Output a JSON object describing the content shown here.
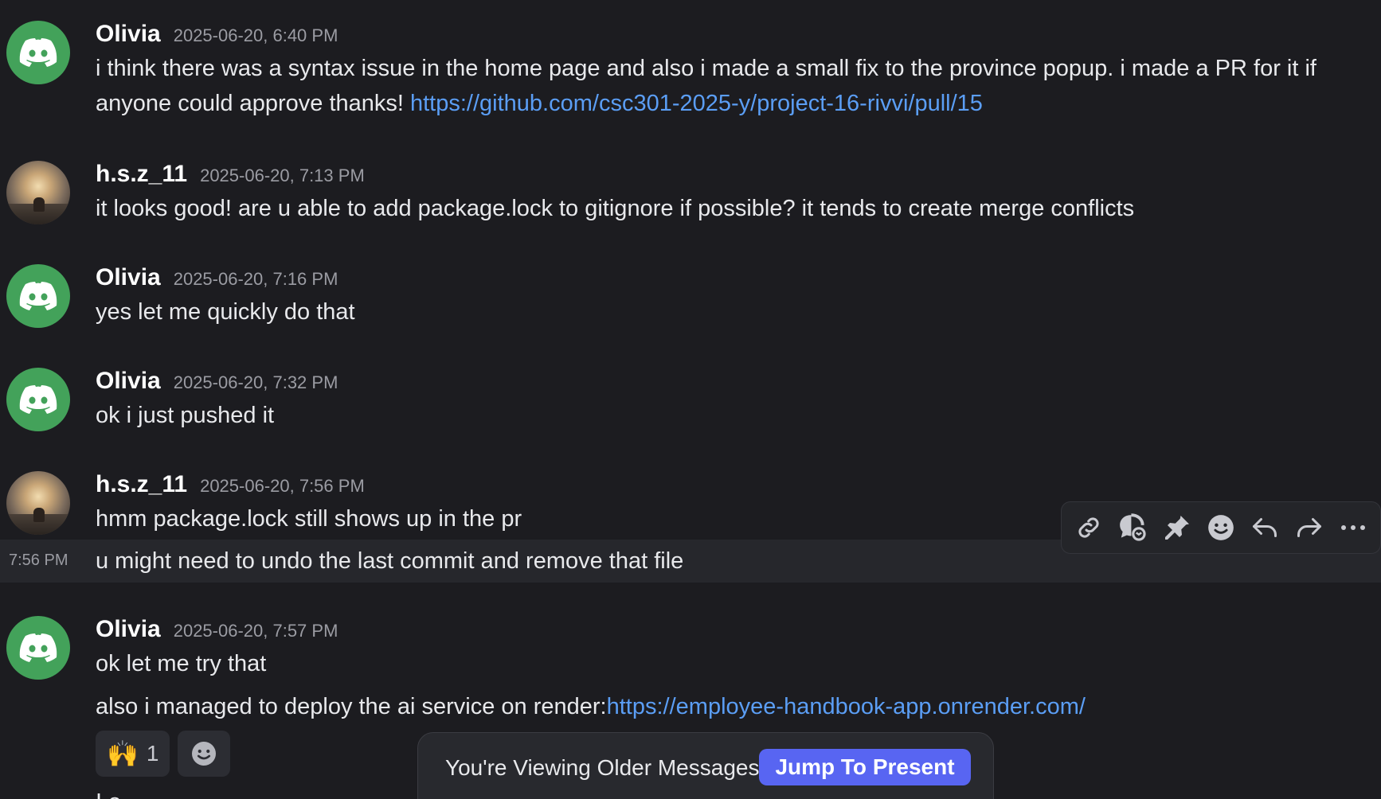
{
  "messages": [
    {
      "username": "Olivia",
      "avatar": "discord-icon",
      "timestamp": "2025-06-20, 6:40 PM",
      "text": "i think there was a syntax issue in the home page and also i made a small fix to the province popup. i made a PR for it if anyone could approve thanks! ",
      "link": "https://github.com/csc301-2025-y/project-16-rivvi/pull/15"
    },
    {
      "username": "h.s.z_11",
      "avatar": "photo",
      "timestamp": "2025-06-20, 7:13 PM",
      "text": "it looks good! are u able to add package.lock to gitignore if possible? it tends to create merge conflicts"
    },
    {
      "username": "Olivia",
      "avatar": "discord-icon",
      "timestamp": "2025-06-20, 7:16 PM",
      "text": "yes let me quickly do that"
    },
    {
      "username": "Olivia",
      "avatar": "discord-icon",
      "timestamp": "2025-06-20, 7:32 PM",
      "text": "ok i just pushed it"
    },
    {
      "username": "h.s.z_11",
      "avatar": "photo",
      "timestamp": "2025-06-20, 7:56 PM",
      "text": "hmm package.lock still shows up in the pr",
      "followup_time": "7:56 PM",
      "followup_text": "u might need to undo the last commit and remove that file"
    },
    {
      "username": "Olivia",
      "avatar": "discord-icon",
      "timestamp": "2025-06-20, 7:57 PM",
      "text": "ok let me try that",
      "followup_text": "also i managed to deploy the ai service on render:",
      "followup_link": "https://employee-handbook-app.onrender.com/"
    }
  ],
  "reactions": [
    {
      "emoji": "🙌",
      "count": "1"
    },
    {
      "emoji": "add-reaction-icon"
    }
  ],
  "toolbar_icons": [
    "link-icon",
    "thread-icon",
    "pin-icon",
    "emoji-icon",
    "reply-icon",
    "forward-icon",
    "more-icon"
  ],
  "banner": {
    "text": "You're Viewing Older Messages",
    "button": "Jump To Present"
  },
  "cut_text": "I a...",
  "colors": {
    "background": "#1c1c20",
    "link": "#5b9ef5",
    "avatar_green": "#43a25a",
    "button_blurple": "#5865f2"
  }
}
